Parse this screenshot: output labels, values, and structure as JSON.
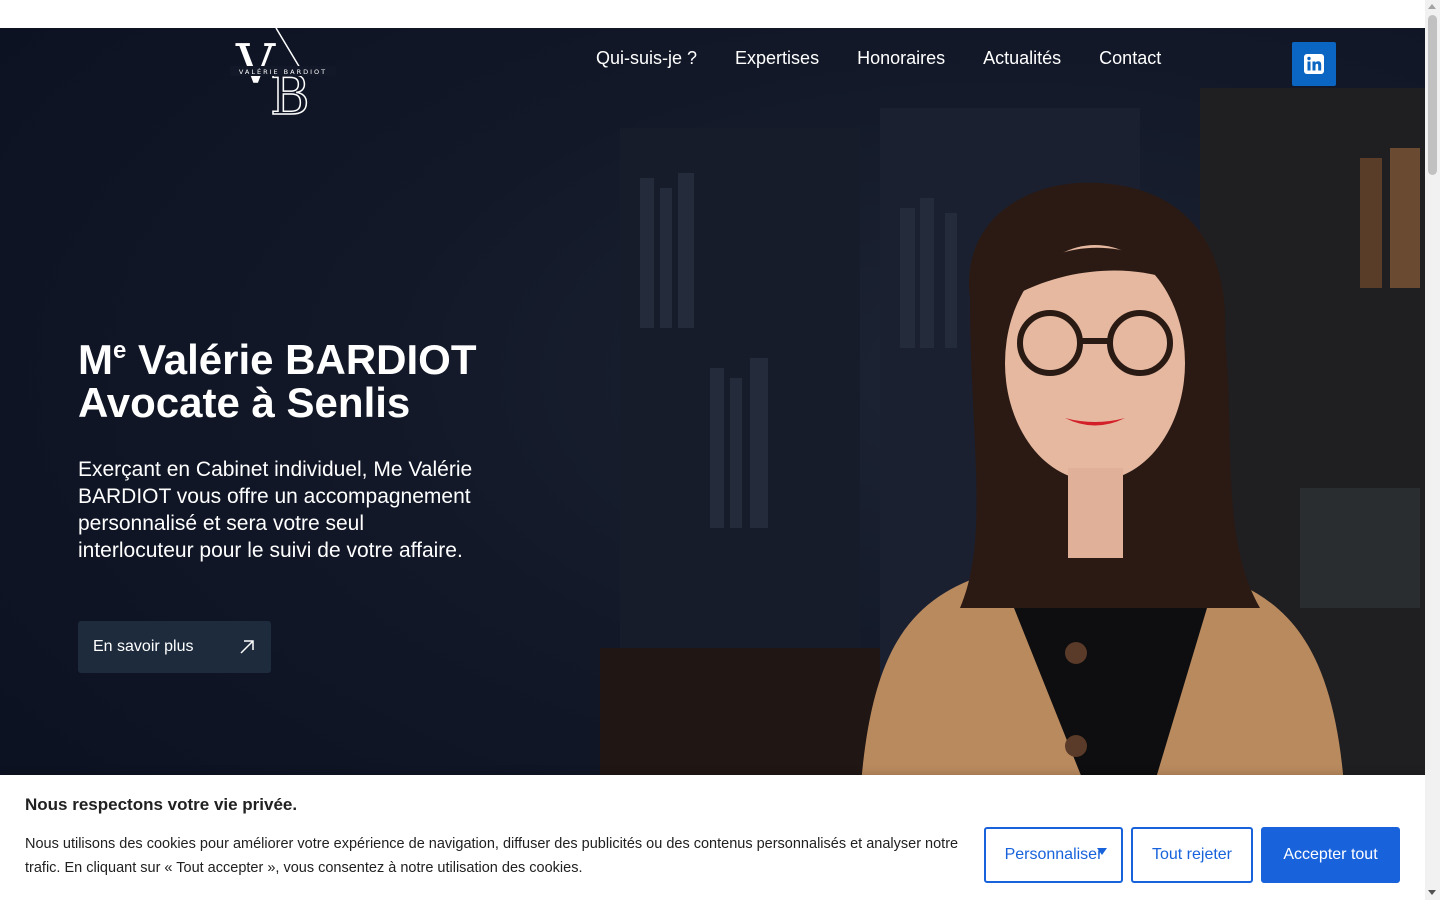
{
  "header": {
    "logo_text": "VALÉRIE BARDIOT",
    "nav": [
      {
        "label": "Qui-suis-je ?"
      },
      {
        "label": "Expertises"
      },
      {
        "label": "Honoraires"
      },
      {
        "label": "Actualités"
      },
      {
        "label": "Contact"
      }
    ],
    "social_icon": "linkedin-icon"
  },
  "hero": {
    "title_prefix": "M",
    "title_sup": "e",
    "title_line1": " Valérie BARDIOT",
    "title_line2": "Avocate à Senlis",
    "description": "Exerçant en Cabinet individuel, Me Valérie BARDIOT vous offre un accompagnement personnalisé et sera votre seul interlocuteur pour le suivi de votre affaire.",
    "cta_label": "En savoir plus",
    "cta_icon": "arrow-up-right-icon"
  },
  "cookie_banner": {
    "title": "Nous respectons votre vie privée.",
    "text": "Nous utilisons des cookies pour améliorer votre expérience de navigation, diffuser des publicités ou des contenus personnalisés et analyser notre trafic. En cliquant sur « Tout accepter », vous consentez à notre utilisation des cookies.",
    "customize_label": "Personnaliser",
    "reject_label": "Tout rejeter",
    "accept_label": "Accepter tout"
  },
  "colors": {
    "accent": "#1863dc",
    "hero_bg": "#121828",
    "cta_bg": "#1d2b3d",
    "linkedin": "#0a66c2"
  }
}
